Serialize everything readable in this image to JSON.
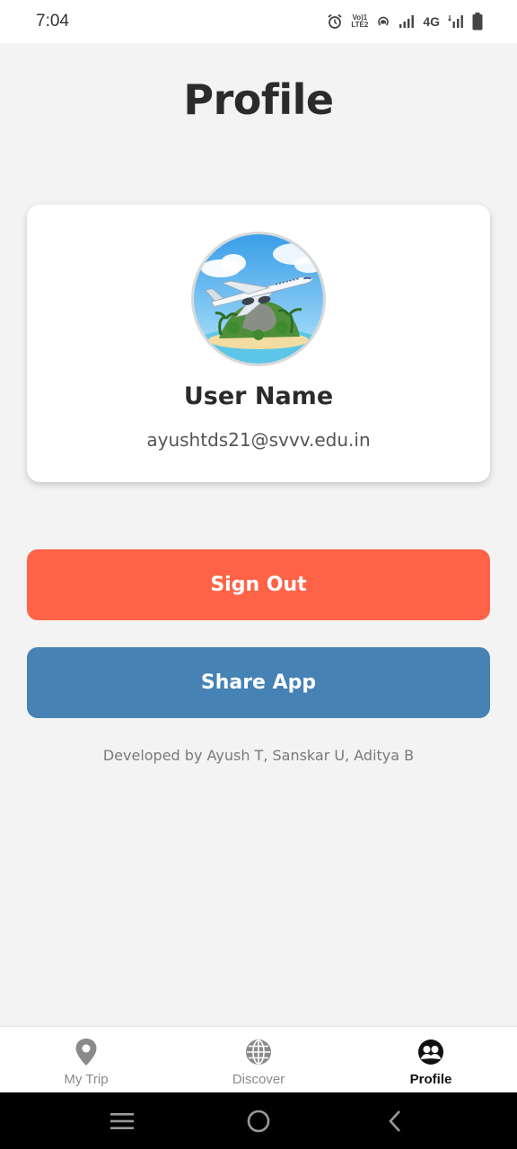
{
  "status_bar": {
    "time": "7:04",
    "volte_top": "Vo)1",
    "volte_bottom": "LTE2",
    "network": "4G",
    "icons": [
      "alarm-icon",
      "volte-icon",
      "hotspot-icon",
      "signal-icon",
      "signal-4g-icon",
      "battery-icon"
    ]
  },
  "page": {
    "title": "Profile"
  },
  "profile": {
    "avatar_icon": "airplane-island-avatar",
    "user_name": "User Name",
    "email": "ayushtds21@svvv.edu.in"
  },
  "actions": {
    "sign_out_label": "Sign Out",
    "share_label": "Share App"
  },
  "credits": "Developed by Ayush T, Sanskar U, Aditya B",
  "tabs": [
    {
      "label": "My Trip",
      "icon": "location-pin-icon",
      "active": false
    },
    {
      "label": "Discover",
      "icon": "globe-icon",
      "active": false
    },
    {
      "label": "Profile",
      "icon": "people-icon",
      "active": true
    }
  ],
  "colors": {
    "sign_out": "#ff6347",
    "share": "#4682b4",
    "background": "#f3f3f3",
    "active_tab": "#111111",
    "inactive_tab": "#8a8a8a"
  },
  "system_nav": [
    "menu-icon",
    "home-icon",
    "back-icon"
  ]
}
